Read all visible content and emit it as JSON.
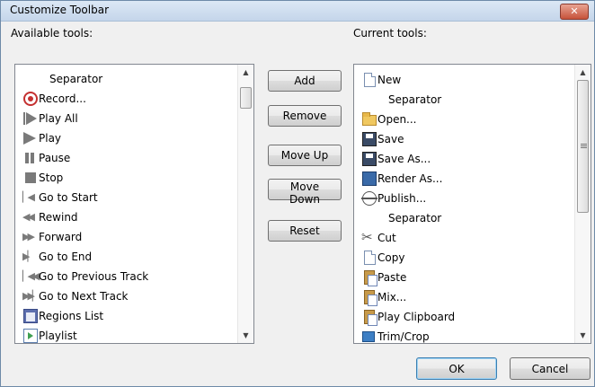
{
  "window": {
    "title": "Customize Toolbar",
    "close_label": "✕"
  },
  "available": {
    "label": "Available tools:",
    "items": [
      {
        "label": "Separator",
        "icon": "none"
      },
      {
        "label": "Record...",
        "icon": "record-icon"
      },
      {
        "label": "Play All",
        "icon": "play-all-icon"
      },
      {
        "label": "Play",
        "icon": "play-icon"
      },
      {
        "label": "Pause",
        "icon": "pause-icon"
      },
      {
        "label": "Stop",
        "icon": "stop-icon"
      },
      {
        "label": "Go to Start",
        "icon": "go-to-start-icon"
      },
      {
        "label": "Rewind",
        "icon": "rewind-icon"
      },
      {
        "label": "Forward",
        "icon": "forward-icon"
      },
      {
        "label": "Go to End",
        "icon": "go-to-end-icon"
      },
      {
        "label": "Go to Previous Track",
        "icon": "previous-track-icon"
      },
      {
        "label": "Go to Next Track",
        "icon": "next-track-icon"
      },
      {
        "label": "Regions List",
        "icon": "regions-list-icon"
      },
      {
        "label": "Playlist",
        "icon": "playlist-icon"
      }
    ]
  },
  "current": {
    "label": "Current tools:",
    "items": [
      {
        "label": "New",
        "icon": "new-document-icon"
      },
      {
        "label": "Separator",
        "icon": "none"
      },
      {
        "label": "Open...",
        "icon": "folder-icon"
      },
      {
        "label": "Save",
        "icon": "save-icon"
      },
      {
        "label": "Save As...",
        "icon": "save-as-icon"
      },
      {
        "label": "Render As...",
        "icon": "render-icon"
      },
      {
        "label": "Publish...",
        "icon": "publish-globe-icon"
      },
      {
        "label": "Separator",
        "icon": "none"
      },
      {
        "label": "Cut",
        "icon": "scissors-icon"
      },
      {
        "label": "Copy",
        "icon": "copy-icon"
      },
      {
        "label": "Paste",
        "icon": "paste-icon"
      },
      {
        "label": "Mix...",
        "icon": "mix-icon"
      },
      {
        "label": "Play Clipboard",
        "icon": "play-clipboard-icon"
      },
      {
        "label": "Trim/Crop",
        "icon": "trim-crop-icon"
      }
    ]
  },
  "buttons": {
    "add": "Add",
    "remove": "Remove",
    "move_up": "Move Up",
    "move_down": "Move Down",
    "reset": "Reset",
    "ok": "OK",
    "cancel": "Cancel"
  },
  "colors": {
    "title_bar": "#c4d5ea",
    "close_button": "#c7523a",
    "dialog_bg": "#f0f0f0",
    "default_button_border": "#3c7fb1"
  }
}
